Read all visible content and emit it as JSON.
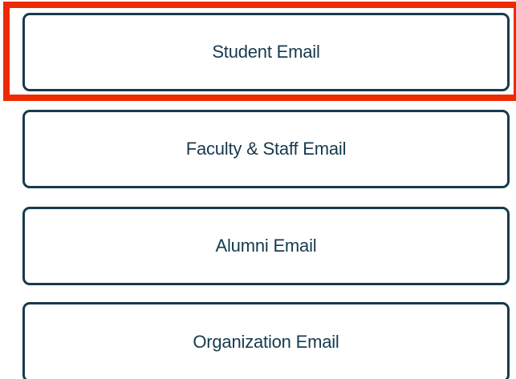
{
  "email_options": [
    {
      "label": "Student Email"
    },
    {
      "label": "Faculty & Staff Email"
    },
    {
      "label": "Alumni Email"
    },
    {
      "label": "Organization Email"
    }
  ],
  "colors": {
    "button_border": "#173a4e",
    "button_text": "#173a4e",
    "highlight": "#ee2a00"
  }
}
